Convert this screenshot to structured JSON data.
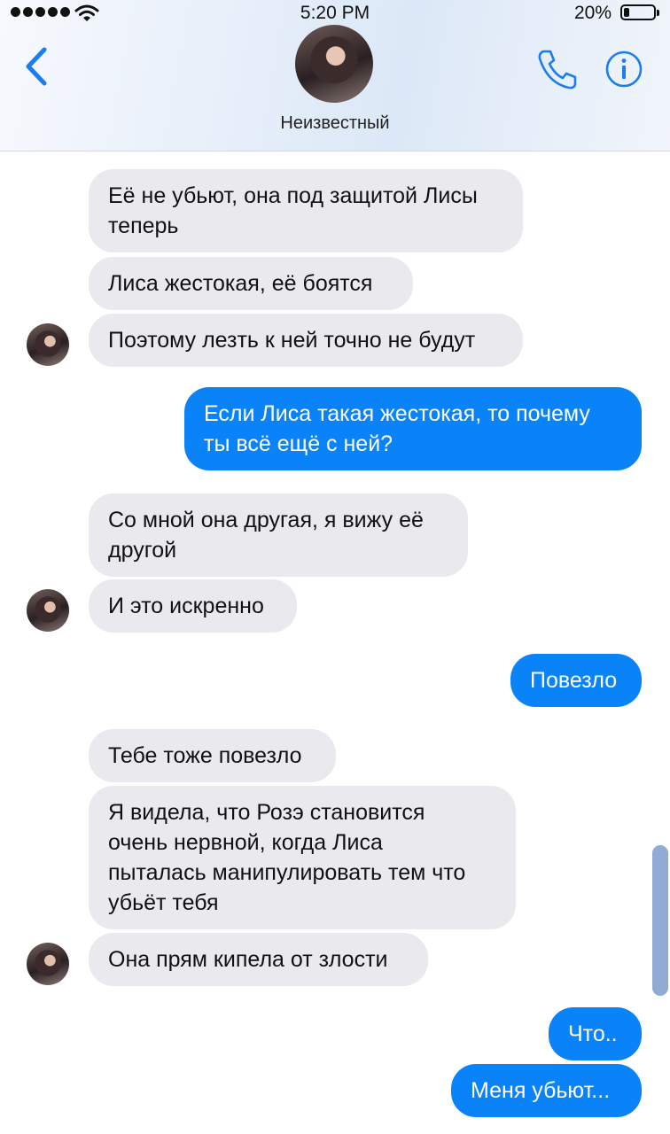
{
  "status_bar": {
    "time": "5:20 PM",
    "battery_percent": "20%",
    "battery_level": 0.2
  },
  "header": {
    "contact_name": "Неизвестный"
  },
  "messages": [
    {
      "side": "in",
      "text": "Её не убьют, она под защитой Лисы\nтеперь"
    },
    {
      "side": "in",
      "text": "Лиса жестокая, её боятся"
    },
    {
      "side": "in",
      "text": "Поэтому лезть к ней точно не будут"
    },
    {
      "side": "out",
      "text": "Если Лиса такая жестокая, то почему\nты всё ещё с ней?"
    },
    {
      "side": "in",
      "text": "Со мной она другая, я вижу её\nдругой"
    },
    {
      "side": "in",
      "text": "И это искренно"
    },
    {
      "side": "out",
      "text": "Повезло"
    },
    {
      "side": "in",
      "text": "Тебе тоже повезло"
    },
    {
      "side": "in",
      "text": "Я видела, что Розэ становится\nочень нервной, когда Лиса\nпыталась манипулировать тем что\nубьёт тебя"
    },
    {
      "side": "in",
      "text": "Она прям кипела от злости"
    },
    {
      "side": "out",
      "text": "Что.."
    },
    {
      "side": "out",
      "text": "Меня убьют..."
    }
  ],
  "colors": {
    "incoming_bubble": "#e9e9ee",
    "outgoing_bubble": "#0a83f8",
    "accent": "#1b7ef0"
  }
}
